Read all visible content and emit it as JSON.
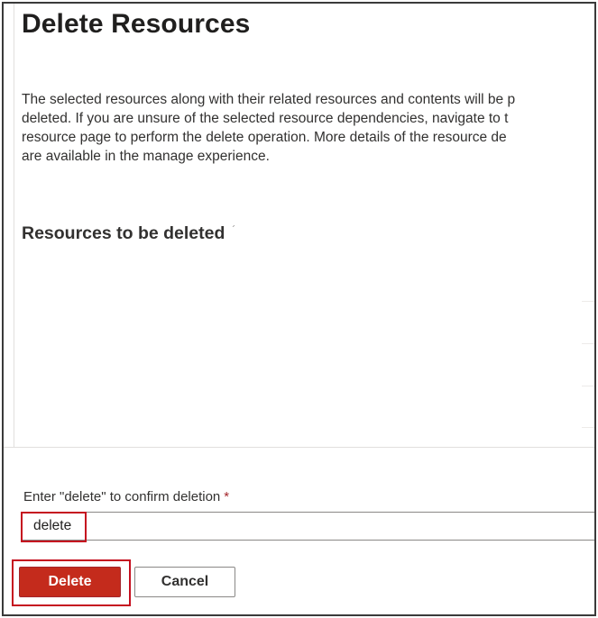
{
  "dialog": {
    "title": "Delete Resources",
    "description_lines": [
      "The selected resources along with their related resources and contents will be p",
      "deleted. If you are unsure of the selected resource dependencies, navigate to t",
      "resource page to perform the delete operation. More details of the resource de",
      "are available in the manage experience."
    ],
    "section_heading": "Resources to be deleted",
    "collapse_glyph": "´",
    "confirm": {
      "label": "Enter \"delete\" to confirm deletion",
      "required_marker": "*",
      "value": "delete"
    },
    "buttons": {
      "delete_label": "Delete",
      "cancel_label": "Cancel"
    }
  },
  "colors": {
    "danger": "#c42b1c",
    "highlight": "#c50f1f",
    "text": "#323130"
  }
}
